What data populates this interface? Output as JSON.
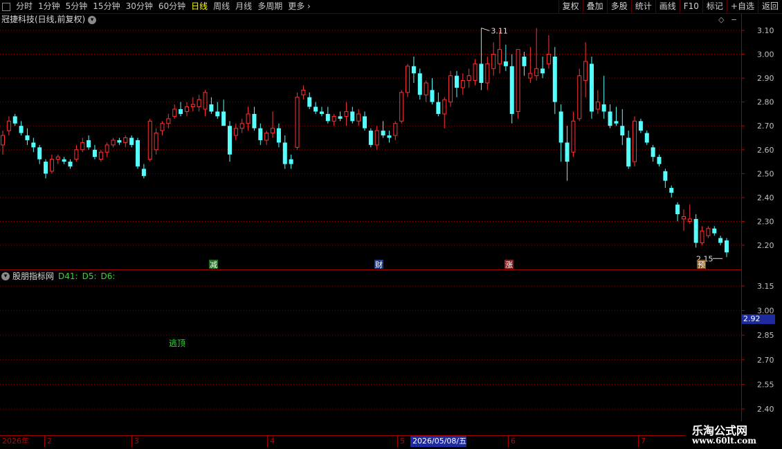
{
  "toolbar": {
    "periods": [
      "分时",
      "1分钟",
      "5分钟",
      "15分钟",
      "30分钟",
      "60分钟",
      "日线",
      "周线",
      "月线",
      "多周期",
      "更多"
    ],
    "active_period": "日线",
    "buttons": [
      "复权",
      "叠加",
      "多股",
      "统计",
      "画线",
      "F10",
      "标记",
      "+自选",
      "返回"
    ]
  },
  "main": {
    "stock_title": "冠捷科技(日线,前复权)",
    "dropdown_icon": "chevron-down-icon",
    "price_axis": [
      "3.10",
      "3.00",
      "2.90",
      "2.80",
      "2.70",
      "2.60",
      "2.50",
      "2.40",
      "2.30",
      "2.20"
    ],
    "high_label": "3.11",
    "low_label": "2.15",
    "markers": [
      {
        "text": "减",
        "color": "#1e6e1e"
      },
      {
        "text": "财",
        "color": "#1e3a8a"
      },
      {
        "text": "涨",
        "color": "#8a1e1e"
      },
      {
        "text": "预",
        "color": "#8a5a1e"
      }
    ]
  },
  "indicator": {
    "name": "股朋指标网",
    "values": [
      "D41:",
      "D5:",
      "D6:"
    ],
    "signal": "逃顶",
    "axis": [
      "3.15",
      "3.00",
      "2.85",
      "2.70",
      "2.55",
      "2.40"
    ],
    "current_price": "2.92"
  },
  "timeline": {
    "labels": [
      "2026年",
      "2",
      "3",
      "4",
      "5",
      "2026/05/08/五",
      "6",
      "7"
    ],
    "highlight": "2026/05/08/五"
  },
  "watermark": {
    "title": "乐淘公式网",
    "url": "www.60lt.com"
  },
  "colors": {
    "up": "#ff3333",
    "down": "#54ffff",
    "grid": "#8b0000",
    "axis_text": "#c0c0c0"
  },
  "chart_data": {
    "type": "candlestick",
    "title": "冠捷科技(日线,前复权)",
    "y_range": [
      2.13,
      3.16
    ],
    "x_labels": [
      "2026年",
      "2",
      "3",
      "4",
      "5",
      "6",
      "7"
    ],
    "ohlc": [
      [
        2.62,
        2.68,
        2.58,
        2.66
      ],
      [
        2.68,
        2.74,
        2.66,
        2.72
      ],
      [
        2.74,
        2.75,
        2.7,
        2.71
      ],
      [
        2.7,
        2.72,
        2.66,
        2.67
      ],
      [
        2.66,
        2.69,
        2.62,
        2.64
      ],
      [
        2.63,
        2.65,
        2.59,
        2.61
      ],
      [
        2.61,
        2.62,
        2.54,
        2.56
      ],
      [
        2.55,
        2.56,
        2.48,
        2.5
      ],
      [
        2.51,
        2.58,
        2.5,
        2.56
      ],
      [
        2.56,
        2.58,
        2.54,
        2.57
      ],
      [
        2.56,
        2.57,
        2.54,
        2.55
      ],
      [
        2.55,
        2.56,
        2.52,
        2.53
      ],
      [
        2.56,
        2.62,
        2.55,
        2.6
      ],
      [
        2.6,
        2.65,
        2.59,
        2.63
      ],
      [
        2.64,
        2.66,
        2.6,
        2.61
      ],
      [
        2.6,
        2.62,
        2.56,
        2.57
      ],
      [
        2.56,
        2.6,
        2.55,
        2.59
      ],
      [
        2.59,
        2.63,
        2.57,
        2.62
      ],
      [
        2.62,
        2.65,
        2.61,
        2.64
      ],
      [
        2.64,
        2.65,
        2.62,
        2.63
      ],
      [
        2.63,
        2.66,
        2.61,
        2.65
      ],
      [
        2.65,
        2.66,
        2.61,
        2.62
      ],
      [
        2.64,
        2.65,
        2.52,
        2.53
      ],
      [
        2.52,
        2.54,
        2.48,
        2.49
      ],
      [
        2.56,
        2.73,
        2.55,
        2.72
      ],
      [
        2.6,
        2.69,
        2.58,
        2.67
      ],
      [
        2.68,
        2.72,
        2.66,
        2.71
      ],
      [
        2.71,
        2.75,
        2.69,
        2.73
      ],
      [
        2.74,
        2.79,
        2.73,
        2.77
      ],
      [
        2.77,
        2.8,
        2.74,
        2.75
      ],
      [
        2.76,
        2.8,
        2.74,
        2.78
      ],
      [
        2.78,
        2.82,
        2.76,
        2.79
      ],
      [
        2.78,
        2.83,
        2.76,
        2.81
      ],
      [
        2.77,
        2.85,
        2.74,
        2.84
      ],
      [
        2.79,
        2.82,
        2.75,
        2.76
      ],
      [
        2.76,
        2.8,
        2.73,
        2.74
      ],
      [
        2.76,
        2.81,
        2.71,
        2.7
      ],
      [
        2.7,
        2.72,
        2.55,
        2.58
      ],
      [
        2.66,
        2.71,
        2.64,
        2.69
      ],
      [
        2.69,
        2.73,
        2.67,
        2.71
      ],
      [
        2.71,
        2.78,
        2.68,
        2.75
      ],
      [
        2.75,
        2.78,
        2.68,
        2.69
      ],
      [
        2.69,
        2.71,
        2.62,
        2.64
      ],
      [
        2.64,
        2.68,
        2.62,
        2.67
      ],
      [
        2.67,
        2.76,
        2.65,
        2.69
      ],
      [
        2.69,
        2.71,
        2.61,
        2.63
      ],
      [
        2.63,
        2.66,
        2.52,
        2.54
      ],
      [
        2.56,
        2.58,
        2.52,
        2.54
      ],
      [
        2.61,
        2.84,
        2.6,
        2.82
      ],
      [
        2.83,
        2.87,
        2.81,
        2.85
      ],
      [
        2.82,
        2.84,
        2.77,
        2.78
      ],
      [
        2.78,
        2.8,
        2.75,
        2.76
      ],
      [
        2.76,
        2.78,
        2.74,
        2.75
      ],
      [
        2.75,
        2.78,
        2.71,
        2.72
      ],
      [
        2.72,
        2.75,
        2.7,
        2.74
      ],
      [
        2.74,
        2.76,
        2.72,
        2.73
      ],
      [
        2.74,
        2.8,
        2.7,
        2.76
      ],
      [
        2.76,
        2.78,
        2.71,
        2.72
      ],
      [
        2.72,
        2.77,
        2.7,
        2.75
      ],
      [
        2.74,
        2.76,
        2.68,
        2.69
      ],
      [
        2.68,
        2.69,
        2.61,
        2.62
      ],
      [
        2.62,
        2.7,
        2.6,
        2.68
      ],
      [
        2.68,
        2.72,
        2.65,
        2.66
      ],
      [
        2.66,
        2.68,
        2.63,
        2.65
      ],
      [
        2.66,
        2.72,
        2.64,
        2.71
      ],
      [
        2.72,
        2.85,
        2.71,
        2.84
      ],
      [
        2.84,
        2.96,
        2.82,
        2.95
      ],
      [
        2.95,
        2.99,
        2.88,
        2.92
      ],
      [
        2.92,
        2.94,
        2.81,
        2.83
      ],
      [
        2.83,
        2.89,
        2.8,
        2.88
      ],
      [
        2.85,
        2.9,
        2.79,
        2.8
      ],
      [
        2.8,
        2.84,
        2.74,
        2.75
      ],
      [
        2.75,
        2.82,
        2.69,
        2.81
      ],
      [
        2.8,
        2.93,
        2.78,
        2.91
      ],
      [
        2.91,
        2.93,
        2.82,
        2.86
      ],
      [
        2.86,
        2.92,
        2.83,
        2.89
      ],
      [
        2.89,
        2.94,
        2.86,
        2.91
      ],
      [
        2.89,
        2.98,
        2.87,
        2.96
      ],
      [
        2.96,
        3.11,
        2.85,
        2.88
      ],
      [
        2.88,
        2.99,
        2.85,
        2.96
      ],
      [
        2.94,
        3.05,
        2.91,
        3.0
      ],
      [
        2.96,
        3.1,
        2.92,
        3.02
      ],
      [
        2.97,
        3.04,
        2.93,
        2.95
      ],
      [
        2.95,
        3.0,
        2.71,
        2.75
      ],
      [
        2.76,
        3.02,
        2.73,
        3.02
      ],
      [
        2.99,
        3.01,
        2.91,
        2.95
      ],
      [
        2.9,
        3.03,
        2.88,
        2.92
      ],
      [
        2.91,
        3.11,
        2.89,
        2.94
      ],
      [
        2.94,
        2.99,
        2.9,
        2.92
      ],
      [
        2.96,
        3.08,
        2.94,
        3.0
      ],
      [
        2.99,
        3.03,
        2.75,
        2.8
      ],
      [
        2.76,
        2.79,
        2.55,
        2.63
      ],
      [
        2.63,
        2.7,
        2.47,
        2.55
      ],
      [
        2.59,
        2.76,
        2.57,
        2.72
      ],
      [
        2.73,
        2.94,
        2.72,
        2.91
      ],
      [
        2.89,
        3.05,
        2.82,
        2.97
      ],
      [
        2.96,
        2.99,
        2.73,
        2.76
      ],
      [
        2.77,
        2.85,
        2.75,
        2.8
      ],
      [
        2.79,
        2.91,
        2.73,
        2.76
      ],
      [
        2.76,
        2.79,
        2.69,
        2.7
      ],
      [
        2.72,
        2.78,
        2.7,
        2.71
      ],
      [
        2.7,
        2.77,
        2.62,
        2.66
      ],
      [
        2.65,
        2.68,
        2.52,
        2.53
      ],
      [
        2.55,
        2.74,
        2.53,
        2.72
      ],
      [
        2.72,
        2.73,
        2.67,
        2.68
      ],
      [
        2.67,
        2.68,
        2.62,
        2.63
      ],
      [
        2.61,
        2.62,
        2.55,
        2.57
      ],
      [
        2.57,
        2.58,
        2.53,
        2.54
      ],
      [
        2.51,
        2.52,
        2.44,
        2.47
      ],
      [
        2.44,
        2.45,
        2.4,
        2.42
      ],
      [
        2.37,
        2.38,
        2.3,
        2.33
      ],
      [
        2.31,
        2.35,
        2.26,
        2.32
      ],
      [
        2.3,
        2.37,
        2.29,
        2.31
      ],
      [
        2.31,
        2.33,
        2.19,
        2.21
      ],
      [
        2.21,
        2.28,
        2.2,
        2.26
      ],
      [
        2.24,
        2.28,
        2.23,
        2.27
      ],
      [
        2.27,
        2.28,
        2.24,
        2.25
      ],
      [
        2.23,
        2.24,
        2.2,
        2.21
      ],
      [
        2.22,
        2.23,
        2.15,
        2.17
      ]
    ]
  }
}
